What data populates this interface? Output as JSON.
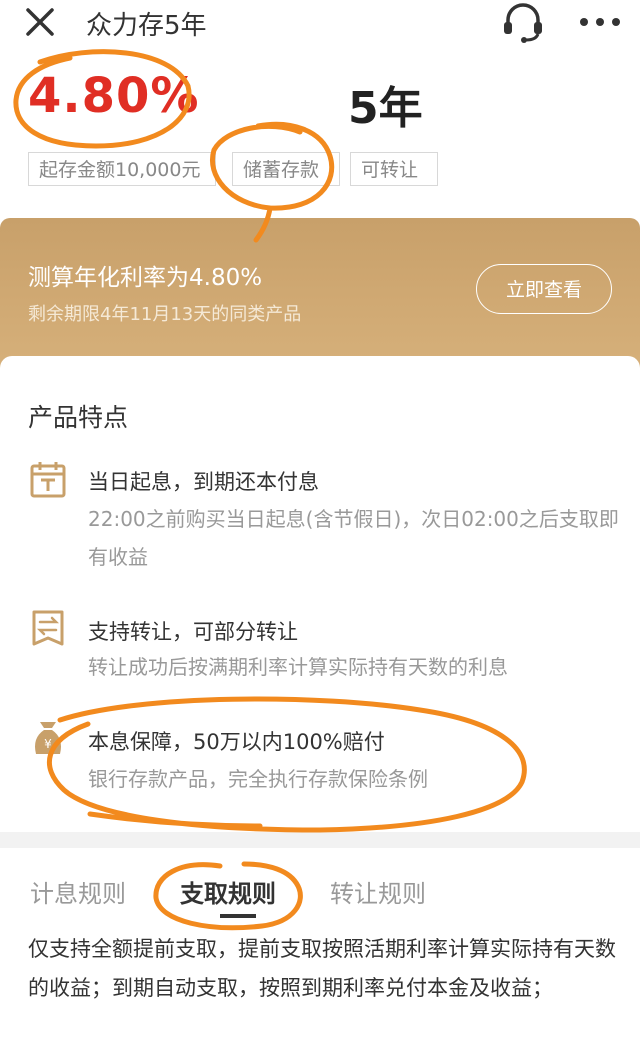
{
  "header": {
    "title": "众力存5年",
    "close_icon": "close-icon",
    "service_icon": "headset-icon",
    "more_icon": "more-dots-icon"
  },
  "product": {
    "rate": "4.80%",
    "term": "5年",
    "tags": [
      "起存金额10,000元",
      "储蓄存款",
      "可转让"
    ]
  },
  "banner": {
    "title": "测算年化利率为4.80%",
    "subtitle": "剩余期限4年11月13天的同类产品",
    "button": "立即查看"
  },
  "features": {
    "section_title": "产品特点",
    "items": [
      {
        "icon": "calendar-icon",
        "title": "当日起息，到期还本付息",
        "desc": "22:00之前购买当日起息(含节假日)，次日02:00之后支取即有收益"
      },
      {
        "icon": "transfer-icon",
        "title": "支持转让，可部分转让",
        "desc": "转让成功后按满期利率计算实际持有天数的利息"
      },
      {
        "icon": "money-bag-icon",
        "title": "本息保障，50万以内100%赔付",
        "desc": "银行存款产品，完全执行存款保险条例"
      }
    ]
  },
  "rules": {
    "tabs": [
      "计息规则",
      "支取规则",
      "转让规则"
    ],
    "active_tab": "支取规则",
    "content": "仅支持全额提前支取，提前支取按照活期利率计算实际持有天数的收益；到期自动支取，按照到期利率兑付本金及收益；"
  },
  "colors": {
    "rate_red": "#e02e24",
    "banner_gold": "#c8a06a",
    "annotation_orange": "#f28a1e"
  }
}
